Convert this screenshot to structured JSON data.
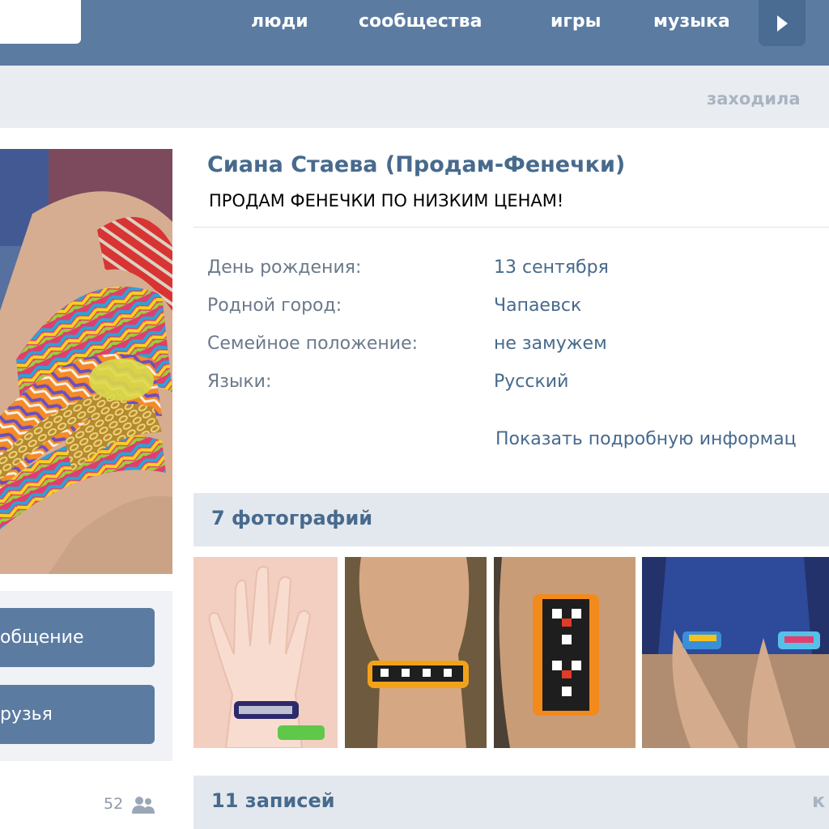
{
  "nav": {
    "links": [
      "люди",
      "сообщества",
      "игры",
      "музыка"
    ]
  },
  "status": {
    "last_seen": "заходила"
  },
  "profile": {
    "name": "Сиана Стаева (Продам-Фенечки)",
    "status": "ПРОДАМ ФЕНЕЧКИ ПО НИЗКИМ ЦЕНАМ!",
    "info": [
      {
        "label": "День рождения:",
        "value": "13 сентября"
      },
      {
        "label": "Родной город:",
        "value": "Чапаевск"
      },
      {
        "label": "Семейное положение:",
        "value": "не замужем"
      },
      {
        "label": "Языки:",
        "value": "Русский"
      }
    ],
    "show_more": "Показать подробную информац"
  },
  "actions": {
    "message_button": "общение",
    "friends_button": "рузья",
    "friends_count": "52"
  },
  "photos": {
    "title": "7 фотографий",
    "count": 4
  },
  "posts": {
    "title": "11 записей",
    "extra": "к"
  },
  "colors": {
    "header_bg": "#5b7ba1",
    "accent_text": "#476a8d",
    "strip_bg": "#e9edf1"
  },
  "icons": [
    "chevron-right-icon",
    "friends-icon"
  ]
}
